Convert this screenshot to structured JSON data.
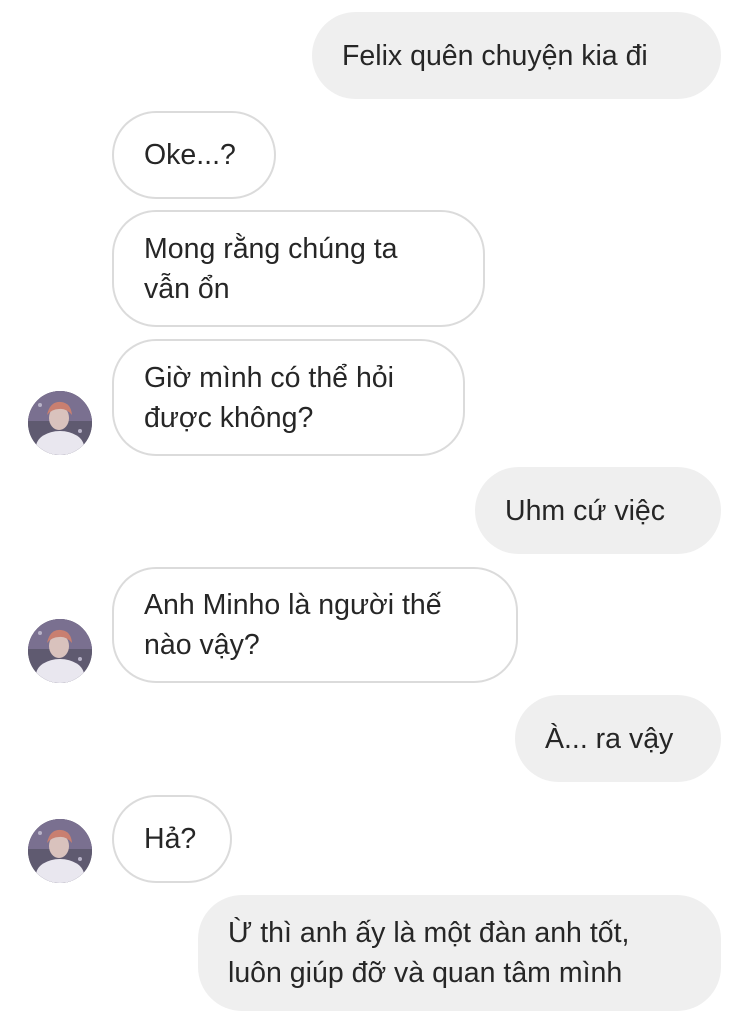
{
  "chat": {
    "messages": [
      {
        "side": "out",
        "text": "Felix quên chuyện kia đi"
      },
      {
        "side": "in",
        "text": "Oke...?"
      },
      {
        "side": "in",
        "text": " Mong rằng chúng ta\nvẫn ổn"
      },
      {
        "side": "in",
        "text": "Giờ mình có thể hỏi\nđược không?"
      },
      {
        "side": "out",
        "text": "Uhm cứ việc"
      },
      {
        "side": "in",
        "text": "Anh Minho là người thế\nnào vậy?"
      },
      {
        "side": "out",
        "text": "À... ra vậy"
      },
      {
        "side": "in",
        "text": "Hả?"
      },
      {
        "side": "out",
        "text": "Ừ thì anh ấy là một đàn anh tốt,\nluôn giúp đỡ và quan tâm mình"
      }
    ]
  },
  "colors": {
    "outgoing_bubble": "#efefef",
    "incoming_border": "#dbdbdb",
    "text": "#262626"
  },
  "icons": {
    "avatar": "contact-avatar-photo"
  }
}
